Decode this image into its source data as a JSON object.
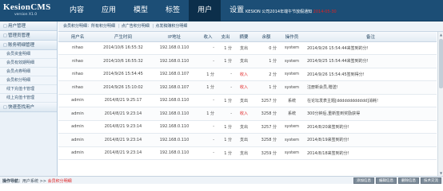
{
  "app": {
    "title": "KesionCMS",
    "version": "version X1.0"
  },
  "nav": {
    "tabs": [
      {
        "label": "内容"
      },
      {
        "label": "应用"
      },
      {
        "label": "模型"
      },
      {
        "label": "标签"
      },
      {
        "label": "用户",
        "active": true
      },
      {
        "label": "设置"
      }
    ],
    "notice_prefix": "KESION 公司2014年端午节放假通知",
    "notice_red": "2014-05-30"
  },
  "sidebar": {
    "sections": [
      {
        "mark": "□",
        "label": "用户管理"
      },
      {
        "mark": "□",
        "label": "管理员管理"
      },
      {
        "mark": "□",
        "label": "账务明细管理"
      }
    ],
    "items": [
      {
        "label": "会员资金明细"
      },
      {
        "label": "会员有效期明细"
      },
      {
        "label": "会员点券明细"
      },
      {
        "label": "会员积分明细"
      },
      {
        "label": "线下充值卡管理"
      },
      {
        "label": "线上充值卡管理"
      }
    ],
    "footer_section": {
      "mark": "□",
      "label": "快速查找用户"
    }
  },
  "subtabs": {
    "items": [
      {
        "label": "会员积分明细：所有积分明细"
      },
      {
        "label": "点广告积分明细"
      },
      {
        "label": "点发稿赚积分明细"
      }
    ]
  },
  "table": {
    "headers": [
      "用户名",
      "产生时间",
      "IP地址",
      "收入",
      "支出",
      "摘要",
      "余额",
      "操作员",
      "备注"
    ],
    "rows": [
      {
        "user": "nihao",
        "time": "2014/10/6 16:55:32",
        "ip": "192.168.0.110",
        "income": "-",
        "expense": "1 分",
        "summary": "支出",
        "summary_red": false,
        "balance": "0 分",
        "operator": "system",
        "note": "2014/9/26 15:54:44来签到的分!"
      },
      {
        "user": "nihao",
        "time": "2014/10/6 16:55:32",
        "ip": "192.168.0.110",
        "income": "-",
        "expense": "1 分",
        "summary": "支出",
        "summary_red": false,
        "balance": "1 分",
        "operator": "system",
        "note": "2014/9/25 15:54:44来签到的分!"
      },
      {
        "user": "nihao",
        "time": "2014/9/26 15:54:45",
        "ip": "192.168.0.107",
        "income": "1 分",
        "expense": "-",
        "summary": "收入",
        "summary_red": true,
        "balance": "2 分",
        "operator": "system",
        "note": "2014/9/26 15:54:45签到得分!"
      },
      {
        "user": "nihao",
        "time": "2014/9/26 15:10:02",
        "ip": "192.168.0.107",
        "income": "1 分",
        "expense": "-",
        "summary": "收入",
        "summary_red": true,
        "balance": "1 分",
        "operator": "system",
        "note": "注册新会员,赠送!"
      },
      {
        "user": "admin",
        "time": "2014/8/21 9:25:17",
        "ip": "192.168.0.110",
        "income": "-",
        "expense": "1 分",
        "summary": "支出",
        "summary_red": false,
        "balance": "3257 分",
        "operator": "系统",
        "note": "在论坛发表主题[dddddddddddd]消耗!"
      },
      {
        "user": "admin",
        "time": "2014/8/21 9:23:14",
        "ip": "192.168.0.110",
        "income": "1 分",
        "expense": "-",
        "summary": "收入",
        "summary_red": true,
        "balance": "3258 分",
        "operator": "系统",
        "note": "300分钟后,重新签到奖励获得"
      },
      {
        "user": "admin",
        "time": "2014/8/21 9:23:14",
        "ip": "192.168.0.110",
        "income": "-",
        "expense": "1 分",
        "summary": "支出",
        "summary_red": false,
        "balance": "3257 分",
        "operator": "system",
        "note": "2014/8/20来签到的分!"
      },
      {
        "user": "admin",
        "time": "2014/8/21 9:23:14",
        "ip": "192.168.0.110",
        "income": "-",
        "expense": "1 分",
        "summary": "支出",
        "summary_red": false,
        "balance": "3258 分",
        "operator": "system",
        "note": "2014/8/19来签到的分!"
      },
      {
        "user": "admin",
        "time": "2014/8/21 9:23:14",
        "ip": "192.168.0.110",
        "income": "-",
        "expense": "1 分",
        "summary": "支出",
        "summary_red": false,
        "balance": "3259 分",
        "operator": "system",
        "note": "2014/8/18来签到的分!"
      }
    ]
  },
  "bottombar": {
    "crumb_label": "操作导航：",
    "crumb_path": "用户系统 >> ",
    "crumb_current": "会员积分明细",
    "buttons": [
      {
        "label": "添加信息"
      },
      {
        "label": "编辑信息"
      },
      {
        "label": "删除信息"
      },
      {
        "label": "技术交流"
      }
    ]
  },
  "colors": {
    "top_bar": "#1c4e76",
    "active_tab": "#0c2f4b",
    "accent_red": "#e02020"
  }
}
